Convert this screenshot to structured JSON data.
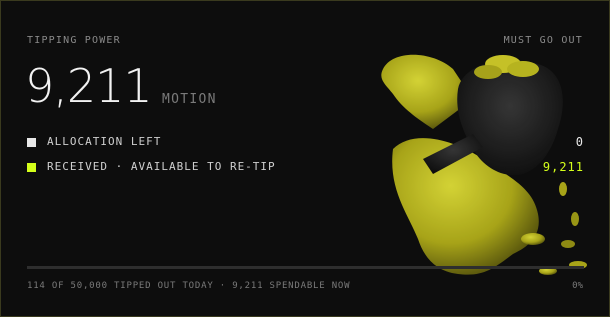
{
  "header": {
    "title": "TIPPING POWER",
    "note": "MUST GO OUT"
  },
  "balance": {
    "amount": "9,211",
    "unit": "MOTION"
  },
  "rows": [
    {
      "label": "ALLOCATION LEFT",
      "value": "0",
      "swatch": "#e8e8e8",
      "value_color": "#e8e8e8"
    },
    {
      "label": "RECEIVED · AVAILABLE TO RE-TIP",
      "value": "9,211",
      "swatch": "#d4ff1a",
      "value_color": "#d4ff1a"
    }
  ],
  "progress": {
    "percent": 0,
    "label": "0%"
  },
  "footer": "114 OF 50,000 TIPPED OUT TODAY · 9,211 SPENDABLE NOW",
  "colors": {
    "accent": "#d4ff1a",
    "border": "#3a3a1e",
    "bg": "#0d0d0d"
  },
  "art": {
    "icon": "money-bag-character-illustration"
  }
}
